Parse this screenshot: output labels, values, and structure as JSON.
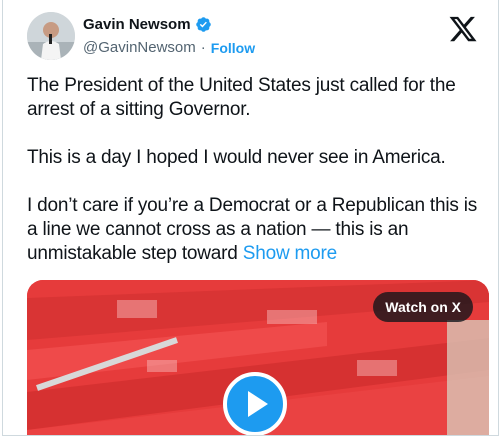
{
  "author": {
    "name": "Gavin Newsom",
    "handle": "@GavinNewsom",
    "separator": "·",
    "follow_label": "Follow",
    "verified_icon": "verified-badge-icon",
    "verified_color": "#1d9bf0"
  },
  "tweet": {
    "paragraphs": [
      "The President of the United States just called for the arrest of a sitting Governor.",
      "This is a day I hoped I would never see in America."
    ],
    "last_paragraph": "I don’t care if you’re a Democrat or a Republican this is a line we cannot cross as a nation — this is an unmistakable step toward",
    "show_more_label": "Show more"
  },
  "media": {
    "watch_label": "Watch on X",
    "play_icon": "play-icon"
  },
  "colors": {
    "accent": "#1d9bf0",
    "text": "#0f1419",
    "muted": "#536471",
    "media_red": "#e63b3b"
  }
}
